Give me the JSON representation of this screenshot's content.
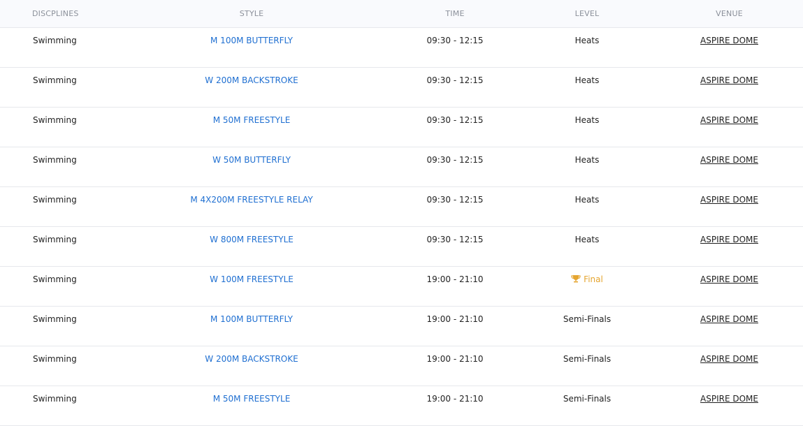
{
  "columns": {
    "discipline": "DISCPLINES",
    "style": "STYLE",
    "time": "TIME",
    "level": "LEVEL",
    "venue": "VENUE"
  },
  "rows": [
    {
      "discipline": "Swimming",
      "style": "M 100M BUTTERFLY",
      "time": "09:30 - 12:15",
      "level": "Heats",
      "is_final": false,
      "venue": "ASPIRE DOME"
    },
    {
      "discipline": "Swimming",
      "style": "W 200M BACKSTROKE",
      "time": "09:30 - 12:15",
      "level": "Heats",
      "is_final": false,
      "venue": "ASPIRE DOME"
    },
    {
      "discipline": "Swimming",
      "style": "M 50M FREESTYLE",
      "time": "09:30 - 12:15",
      "level": "Heats",
      "is_final": false,
      "venue": "ASPIRE DOME"
    },
    {
      "discipline": "Swimming",
      "style": "W 50M BUTTERFLY",
      "time": "09:30 - 12:15",
      "level": "Heats",
      "is_final": false,
      "venue": "ASPIRE DOME"
    },
    {
      "discipline": "Swimming",
      "style": "M 4X200M FREESTYLE RELAY",
      "time": "09:30 - 12:15",
      "level": "Heats",
      "is_final": false,
      "venue": "ASPIRE DOME"
    },
    {
      "discipline": "Swimming",
      "style": "W 800M FREESTYLE",
      "time": "09:30 - 12:15",
      "level": "Heats",
      "is_final": false,
      "venue": "ASPIRE DOME"
    },
    {
      "discipline": "Swimming",
      "style": "W 100M FREESTYLE",
      "time": "19:00 - 21:10",
      "level": "Final",
      "is_final": true,
      "venue": "ASPIRE DOME"
    },
    {
      "discipline": "Swimming",
      "style": "M 100M BUTTERFLY",
      "time": "19:00 - 21:10",
      "level": "Semi-Finals",
      "is_final": false,
      "venue": "ASPIRE DOME"
    },
    {
      "discipline": "Swimming",
      "style": "W 200M BACKSTROKE",
      "time": "19:00 - 21:10",
      "level": "Semi-Finals",
      "is_final": false,
      "venue": "ASPIRE DOME"
    },
    {
      "discipline": "Swimming",
      "style": "M 50M FREESTYLE",
      "time": "19:00 - 21:10",
      "level": "Semi-Finals",
      "is_final": false,
      "venue": "ASPIRE DOME"
    }
  ],
  "colors": {
    "style_link": "#1f6fd1",
    "final": "#e5a530",
    "header_text": "#8b909a",
    "header_bg": "#f9fafd",
    "divider": "#e6e8ec"
  },
  "icons": {
    "final_level": "trophy-icon"
  }
}
